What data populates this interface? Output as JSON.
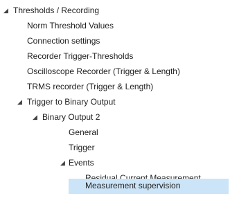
{
  "tree": {
    "nodes": [
      {
        "label": "Thresholds / Recording",
        "expanded": true
      },
      {
        "label": "Norm Threshold Values"
      },
      {
        "label": "Connection settings"
      },
      {
        "label": "Recorder Trigger-Thresholds"
      },
      {
        "label": "Oscilloscope Recorder (Trigger & Length)"
      },
      {
        "label": "TRMS recorder (Trigger & Length)"
      },
      {
        "label": "Trigger to Binary Output",
        "expanded": true
      },
      {
        "label": "Binary Output 2",
        "expanded": true
      },
      {
        "label": "General"
      },
      {
        "label": "Trigger"
      },
      {
        "label": "Events",
        "expanded": true
      },
      {
        "label": "Residual Current Measurement"
      },
      {
        "label": "Measurement supervision",
        "selected": true
      }
    ],
    "expanded_glyph": "◢",
    "selection_color": "#cce4f7"
  }
}
